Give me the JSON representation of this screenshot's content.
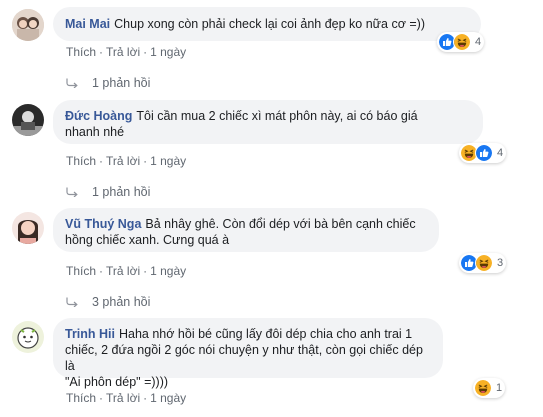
{
  "actions": {
    "like": "Thích",
    "reply": "Trả lời",
    "sep": "·"
  },
  "comments": [
    {
      "author": "Mai Mai",
      "text": "Chup xong còn phải check lại coi ảnh đẹp ko nữa cơ =))",
      "time": "1 ngày",
      "reaction_count": "4",
      "replies": "1 phản hồi",
      "reactions": [
        "like-icon",
        "haha-icon"
      ]
    },
    {
      "author": "Đức Hoàng",
      "text_line1": "Tôi cần mua 2 chiếc xì mát phôn này, ai có báo giá",
      "text_line2": "nhanh nhé",
      "time": "1 ngày",
      "reaction_count": "4",
      "replies": "1 phản hồi",
      "reactions": [
        "haha-icon",
        "like-icon"
      ]
    },
    {
      "author": "Vũ Thuý Nga",
      "text_line1": "Bả nhây ghê. Còn đổi dép với bà bên cạnh chiếc",
      "text_line2": "hồng chiếc xanh. Cưng quá à",
      "time": "1 ngày",
      "reaction_count": "3",
      "replies": "3 phản hồi",
      "reactions": [
        "like-icon",
        "haha-icon"
      ]
    },
    {
      "author": "Trinh Hii",
      "text_line1": "Haha nhớ hồi bé cũng lấy đôi dép chia cho anh trai 1",
      "text_line2": "chiếc, 2 đứa ngồi 2 góc nói chuyện y như thật, còn gọi chiếc dép là",
      "text_line3": "\"Ai phôn dép\" =))))",
      "time": "1 ngày",
      "reaction_count": "1",
      "reactions": [
        "haha-icon"
      ]
    }
  ],
  "colors": {
    "author": "#385898",
    "bubble": "#f2f3f5",
    "meta": "#606770",
    "like": "#1877f2",
    "haha": "#f7b125"
  }
}
